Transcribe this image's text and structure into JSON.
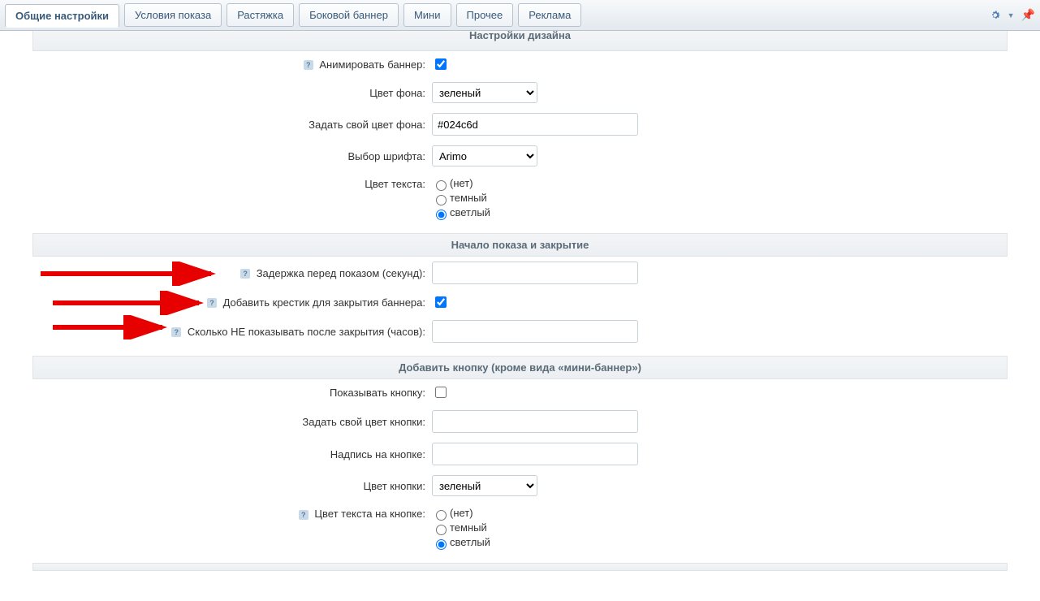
{
  "tabs": {
    "main": "Общие настройки",
    "cond": "Условия показа",
    "stretch": "Растяжка",
    "side": "Боковой баннер",
    "mini": "Мини",
    "misc": "Прочее",
    "ads": "Реклама"
  },
  "sections": {
    "design": "Настройки дизайна",
    "timing": "Начало показа и закрытие",
    "button": "Добавить кнопку (кроме вида «мини-баннер»)"
  },
  "design": {
    "animate_label": "Анимировать баннер:",
    "animate_checked": true,
    "bg_label": "Цвет фона:",
    "bg_value": "зеленый",
    "custom_bg_label": "Задать свой цвет фона:",
    "custom_bg_value": "#024c6d",
    "font_label": "Выбор шрифта:",
    "font_value": "Arimo",
    "text_color_label": "Цвет текста:",
    "tc_none": "(нет)",
    "tc_dark": "темный",
    "tc_light": "светлый"
  },
  "timing": {
    "delay_label": "Задержка перед показом (секунд):",
    "delay_value": "",
    "close_x_label": "Добавить крестик для закрытия баннера:",
    "close_x_checked": true,
    "hide_hours_label": "Сколько НЕ показывать после закрытия (часов):",
    "hide_hours_value": ""
  },
  "button": {
    "show_label": "Показывать кнопку:",
    "show_checked": false,
    "custom_color_label": "Задать свой цвет кнопки:",
    "custom_color_value": "",
    "caption_label": "Надпись на кнопке:",
    "caption_value": "",
    "color_label": "Цвет кнопки:",
    "color_value": "зеленый",
    "text_color_label": "Цвет текста на кнопке:",
    "tc_none": "(нет)",
    "tc_dark": "темный",
    "tc_light": "светлый"
  }
}
